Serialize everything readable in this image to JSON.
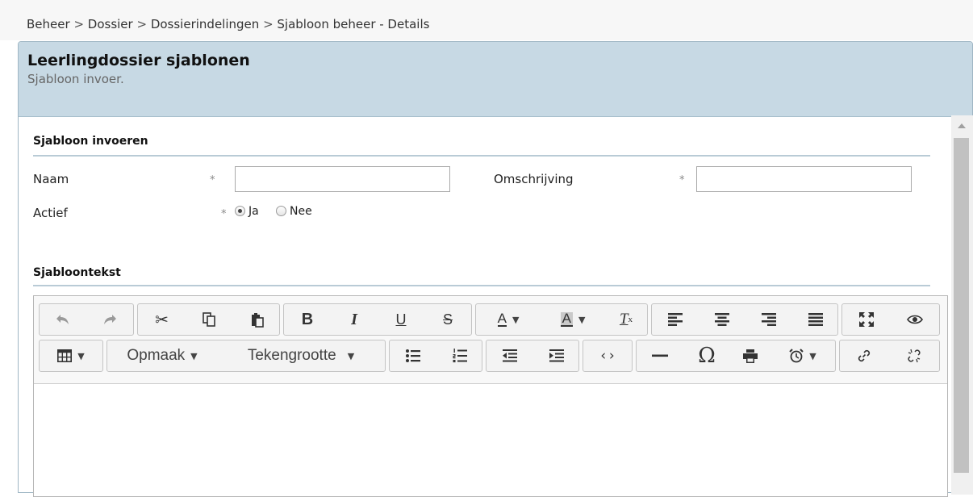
{
  "breadcrumb": {
    "items": [
      "Beheer",
      "Dossier",
      "Dossierindelingen",
      "Sjabloon beheer - Details"
    ],
    "separator": ">"
  },
  "panel": {
    "title": "Leerlingdossier sjablonen",
    "subtitle": "Sjabloon invoer."
  },
  "form": {
    "section_title": "Sjabloon invoeren",
    "required_marker": "*",
    "naam_label": "Naam",
    "naam_value": "",
    "omschrijving_label": "Omschrijving",
    "omschrijving_value": "",
    "actief_label": "Actief",
    "actief_options": [
      "Ja",
      "Nee"
    ],
    "actief_selected": "Ja"
  },
  "editor": {
    "section_title": "Sjabloontekst",
    "format_dropdown": "Opmaak",
    "size_dropdown": "Tekengrootte",
    "content": "",
    "toolbar_row1": [
      "undo-icon",
      "redo-icon",
      "cut-icon",
      "copy-icon",
      "paste-icon",
      "bold-icon",
      "italic-icon",
      "underline-icon",
      "strikethrough-icon",
      "text-color-icon",
      "background-color-icon",
      "remove-format-icon",
      "align-left-icon",
      "align-center-icon",
      "align-right-icon",
      "align-justify-icon",
      "maximize-icon",
      "preview-icon"
    ],
    "toolbar_row2": [
      "table-icon",
      "bulleted-list-icon",
      "numbered-list-icon",
      "outdent-icon",
      "indent-icon",
      "source-icon",
      "horizontal-rule-icon",
      "special-char-icon",
      "print-icon",
      "timestamp-icon",
      "link-icon",
      "unlink-icon"
    ]
  },
  "colors": {
    "header_bg": "#c7d9e4",
    "panel_border": "#9fb6c4",
    "section_rule": "#b9cbd6"
  }
}
